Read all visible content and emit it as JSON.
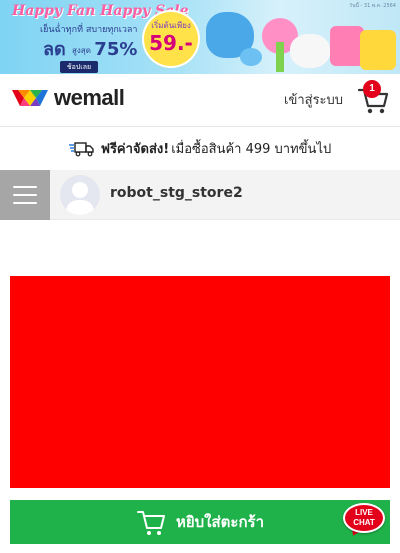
{
  "banner": {
    "title": "Happy Fan Happy Sale",
    "subtitle": "เย็นฉ่ำทุกที่ สบายทุกเวลา",
    "sale_prefix": "ลด",
    "sale_upto": "สูงสุด",
    "sale_percent": "75%",
    "button_label": "ช้อปเลย",
    "price_label": "เริ่มต้นเพียง",
    "price_value": "59.-",
    "date_text": "วันนี้ - 31 พ.ค. 2564"
  },
  "header": {
    "logo_text": "wemall",
    "login_label": "เข้าสู่ระบบ",
    "cart_count": "1"
  },
  "shipping": {
    "highlight": "ฟรีค่าจัดส่ง!",
    "text": "เมื่อซื้อสินค้า 499 บาทขึ้นไป"
  },
  "store": {
    "name": "robot_stg_store2"
  },
  "product": {
    "image_color": "#ff0000"
  },
  "actions": {
    "add_to_cart_label": "หยิบใส่ตะกร้า",
    "live_chat_label_1": "LIVE",
    "live_chat_label_2": "CHAT"
  },
  "colors": {
    "accent_green": "#1fb24a",
    "badge_red": "#e2001a",
    "menu_gray": "#a6a6a6"
  }
}
